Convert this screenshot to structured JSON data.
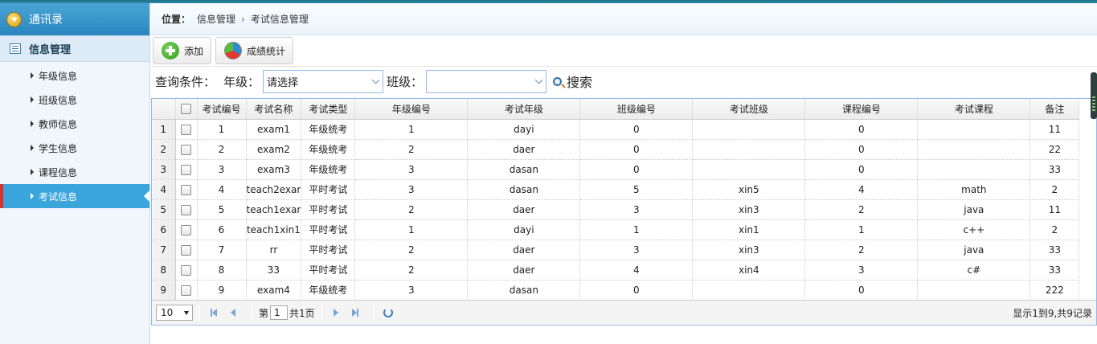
{
  "sidebar": {
    "title": "通讯录",
    "group": "信息管理",
    "items": [
      {
        "label": "年级信息",
        "active": false
      },
      {
        "label": "班级信息",
        "active": false
      },
      {
        "label": "教师信息",
        "active": false
      },
      {
        "label": "学生信息",
        "active": false
      },
      {
        "label": "课程信息",
        "active": false
      },
      {
        "label": "考试信息",
        "active": true
      }
    ]
  },
  "breadcrumb": {
    "label": "位置：",
    "items": [
      "信息管理",
      "考试信息管理"
    ],
    "separator": "›"
  },
  "toolbar": {
    "add_label": "添加",
    "stats_label": "成绩统计"
  },
  "query": {
    "label": "查询条件：",
    "grade_label": "年级：",
    "grade_value": "请选择",
    "class_label": "班级：",
    "class_value": "",
    "search_label": "搜索"
  },
  "table": {
    "columns": [
      "考试编号",
      "考试名称",
      "考试类型",
      "年级编号",
      "考试年级",
      "班级编号",
      "考试班级",
      "课程编号",
      "考试课程",
      "备注"
    ],
    "rows": [
      [
        "1",
        "exam1",
        "年级统考",
        "1",
        "dayi",
        "0",
        "",
        "0",
        "",
        "11"
      ],
      [
        "2",
        "exam2",
        "年级统考",
        "2",
        "daer",
        "0",
        "",
        "0",
        "",
        "22"
      ],
      [
        "3",
        "exam3",
        "年级统考",
        "3",
        "dasan",
        "0",
        "",
        "0",
        "",
        "33"
      ],
      [
        "4",
        "teach2exar",
        "平时考试",
        "3",
        "dasan",
        "5",
        "xin5",
        "4",
        "math",
        "2"
      ],
      [
        "5",
        "teach1exar",
        "平时考试",
        "2",
        "daer",
        "3",
        "xin3",
        "2",
        "java",
        "11"
      ],
      [
        "6",
        "teach1xin1",
        "平时考试",
        "1",
        "dayi",
        "1",
        "xin1",
        "1",
        "c++",
        "2"
      ],
      [
        "7",
        "rr",
        "平时考试",
        "2",
        "daer",
        "3",
        "xin3",
        "2",
        "java",
        "33"
      ],
      [
        "8",
        "33",
        "平时考试",
        "2",
        "daer",
        "4",
        "xin4",
        "3",
        "c#",
        "33"
      ],
      [
        "9",
        "exam4",
        "年级统考",
        "3",
        "dasan",
        "0",
        "",
        "0",
        "",
        "222"
      ]
    ]
  },
  "pager": {
    "page_size": "10",
    "page_prefix": "第",
    "page_value": "1",
    "page_suffix": "共1页",
    "info": "显示1到9,共9记录"
  },
  "colors": {
    "accent": "#3aa5db",
    "active_marker": "#d9322b",
    "border": "#95b8e7"
  }
}
